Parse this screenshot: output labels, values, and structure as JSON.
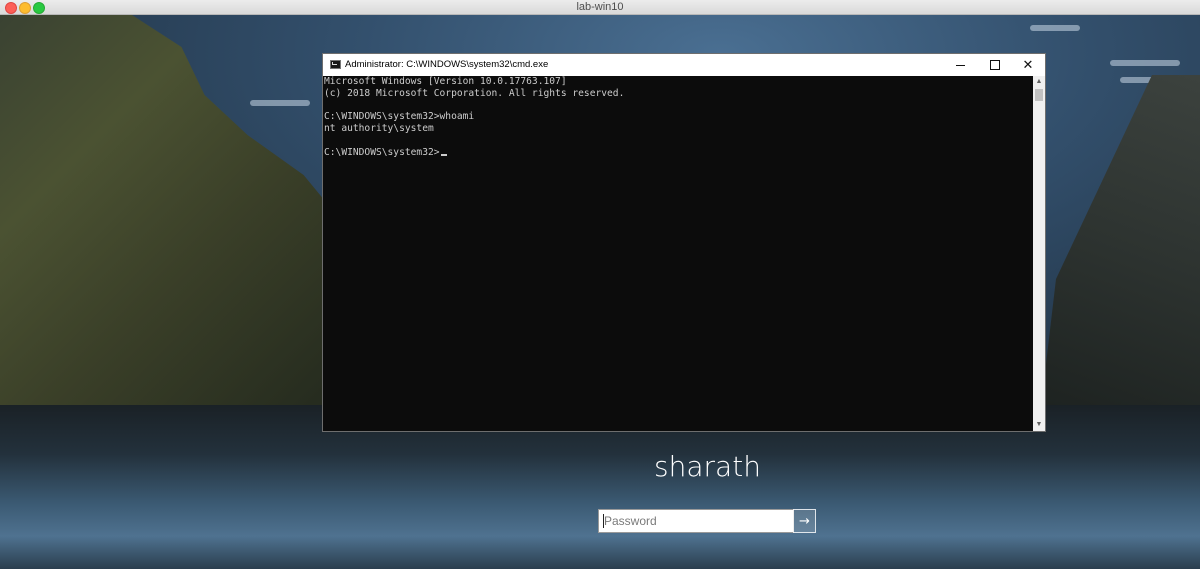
{
  "mac_window": {
    "title": "lab-win10"
  },
  "cmd": {
    "title": "Administrator: C:\\WINDOWS\\system32\\cmd.exe",
    "lines": [
      "Microsoft Windows [Version 10.0.17763.107]",
      "(c) 2018 Microsoft Corporation. All rights reserved.",
      "",
      "C:\\WINDOWS\\system32>whoami",
      "nt authority\\system",
      "",
      "C:\\WINDOWS\\system32>"
    ],
    "icons": {
      "minimize": "minimize-icon",
      "maximize": "maximize-icon",
      "close": "close-icon"
    }
  },
  "login": {
    "username": "sharath",
    "password_placeholder": "Password",
    "submit_icon": "arrow-right-icon"
  },
  "colors": {
    "console_bg": "#0c0c0c",
    "console_text": "#cccccc",
    "titlebar_bg": "#ffffff"
  }
}
